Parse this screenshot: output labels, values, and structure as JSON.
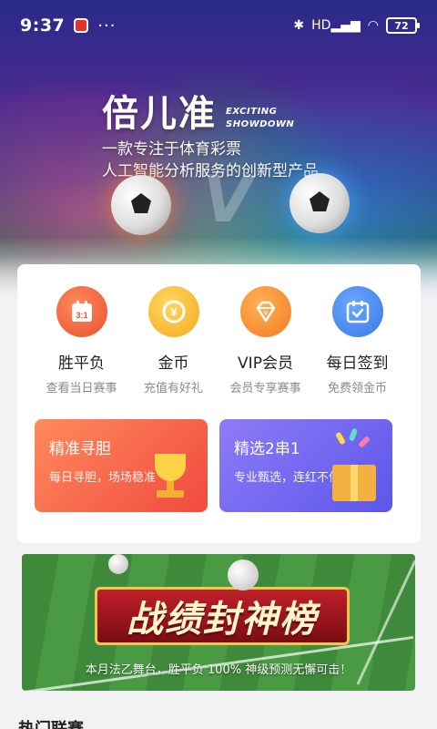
{
  "status_bar": {
    "time": "9:37",
    "more": "···",
    "network": "HD",
    "battery": "72"
  },
  "hero": {
    "brand": "倍儿准",
    "brand_sub_1": "EXCITING",
    "brand_sub_2": "SHOWDOWN",
    "tagline_1": "一款专注于体育彩票",
    "tagline_2": "人工智能分析服务的创新型产品"
  },
  "features": [
    {
      "label": "胜平负",
      "desc": "查看当日赛事",
      "icon": "calendar-score-icon",
      "color": "#f0683c"
    },
    {
      "label": "金币",
      "desc": "充值有好礼",
      "icon": "coin-icon",
      "color": "#f8b62c"
    },
    {
      "label": "VIP会员",
      "desc": "会员专享赛事",
      "icon": "diamond-icon",
      "color": "#f79034"
    },
    {
      "label": "每日签到",
      "desc": "免费领金币",
      "icon": "calendar-check-icon",
      "color": "#4a8cf0"
    }
  ],
  "banners": {
    "left": {
      "title": "精准寻胆",
      "desc": "每日寻胆，场场稳准"
    },
    "right": {
      "title": "精选2串1",
      "desc": "专业甄选，连红不停"
    }
  },
  "promo": {
    "title": "战绩封神榜",
    "caption": "本月法乙舞台，胜平负 100% 神级预测无懈可击！"
  },
  "section": {
    "title": "热门联赛"
  }
}
